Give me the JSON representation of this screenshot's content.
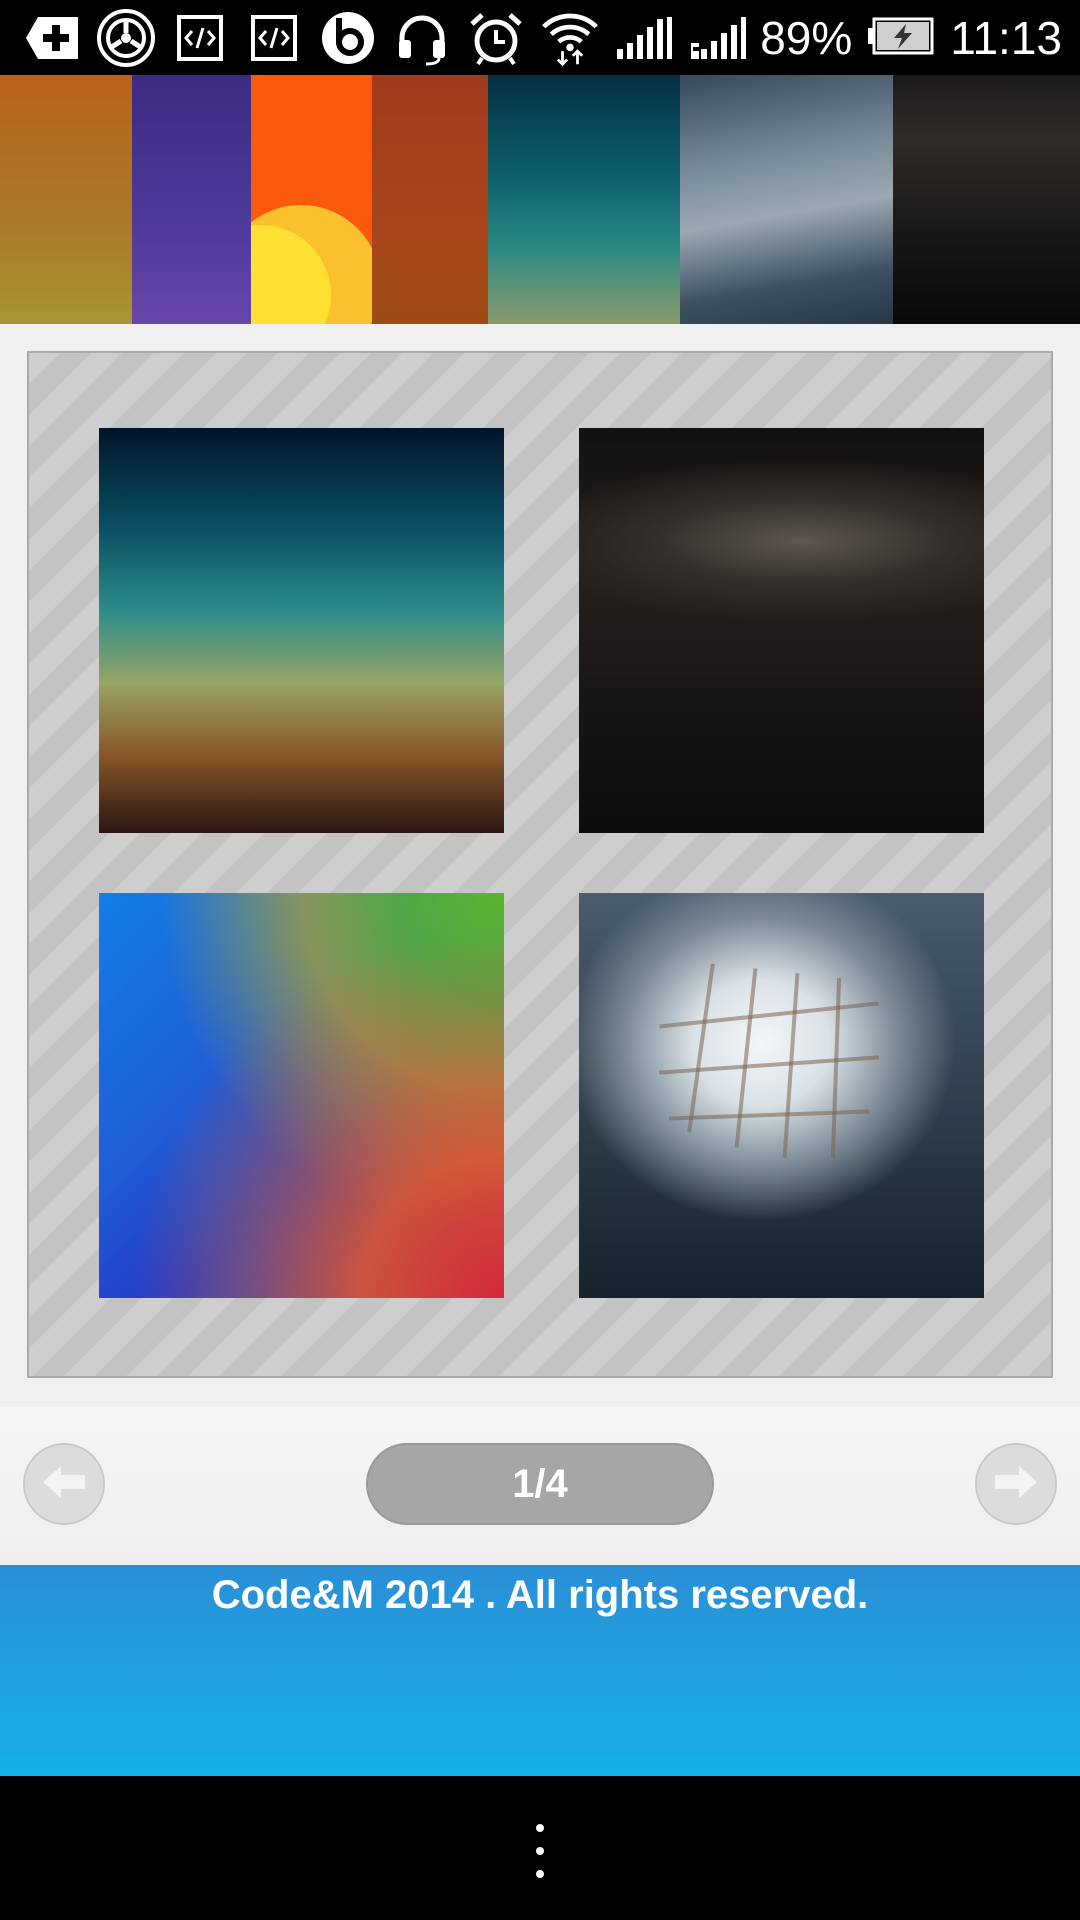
{
  "status_bar": {
    "icons": [
      "add-icon",
      "steering-wheel-icon",
      "code-icon",
      "code-icon",
      "beats-icon",
      "headset-icon",
      "alarm-icon",
      "wifi-icon",
      "signal-icon",
      "signal-icon",
      "battery-charging-icon"
    ],
    "battery_percent": "89%",
    "time": "11:13"
  },
  "wallpaper_strip": {
    "swatch_colors": [
      "#b8611d",
      "#4f3a9a",
      "#fb5a0d",
      "#a8461a",
      "#0c5e6b",
      "#7a8c9a",
      "#1c1a19"
    ]
  },
  "grid": {
    "thumbnails": [
      "gradient-sunset-wallpaper",
      "dark-brushed-metal-wallpaper",
      "rainbow-gradient-wallpaper",
      "frosted-glass-window-wallpaper"
    ]
  },
  "pager": {
    "prev_icon": "arrow-left-icon",
    "page_label": "1/4",
    "next_icon": "arrow-right-icon"
  },
  "footer": {
    "copyright": "Code&M 2014 . All rights reserved."
  },
  "nav_bar": {
    "menu_icon": "overflow-menu-icon"
  }
}
